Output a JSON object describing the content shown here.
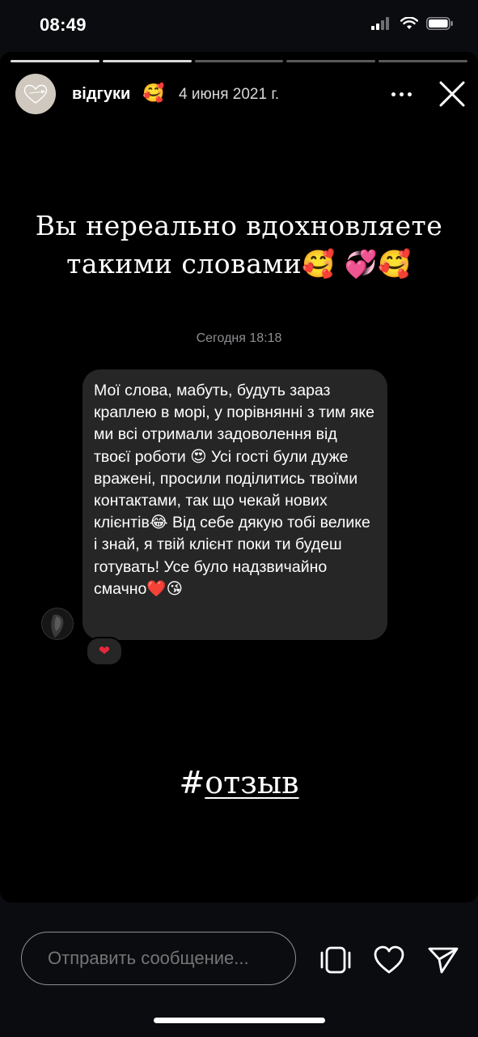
{
  "status_bar": {
    "time": "08:49"
  },
  "story": {
    "progress": {
      "total": 5,
      "current": 2
    },
    "username": "відгуки",
    "username_emoji": "🥰",
    "date": "4 июня 2021 г.",
    "headline_line1": "Вы нереально вдохновляете",
    "headline_line2": "такими словами🥰 💞🥰",
    "message_time": "Сегодня 18:18",
    "message_text": "Мої слова, мабуть, будуть зараз краплею в морі, у порівнянні з тим яке ми всі отримали задоволення від твоєї роботи 😍 Усі гості були дуже вражені, просили поділитись твоїми контактами, так що чекай нових клієнтів😂 Від себе дякую тобі велике і знай, я твій клієнт поки ти будеш готувать! Усе було надзвичайно смачно❤️😘",
    "reaction": "❤",
    "hashtag_symbol": "#",
    "hashtag_word": "отзыв"
  },
  "reply": {
    "placeholder": "Отправить сообщение..."
  },
  "icons": {
    "signal": "cellular-signal-icon",
    "wifi": "wifi-icon",
    "battery": "battery-icon",
    "more": "more-icon",
    "close": "close-icon",
    "repost": "repost-icon",
    "like": "heart-icon",
    "send": "send-icon"
  },
  "colors": {
    "background": "#000000",
    "bubble": "#262626",
    "reaction_heart": "#e8273a",
    "muted_text": "#8e8e93"
  }
}
